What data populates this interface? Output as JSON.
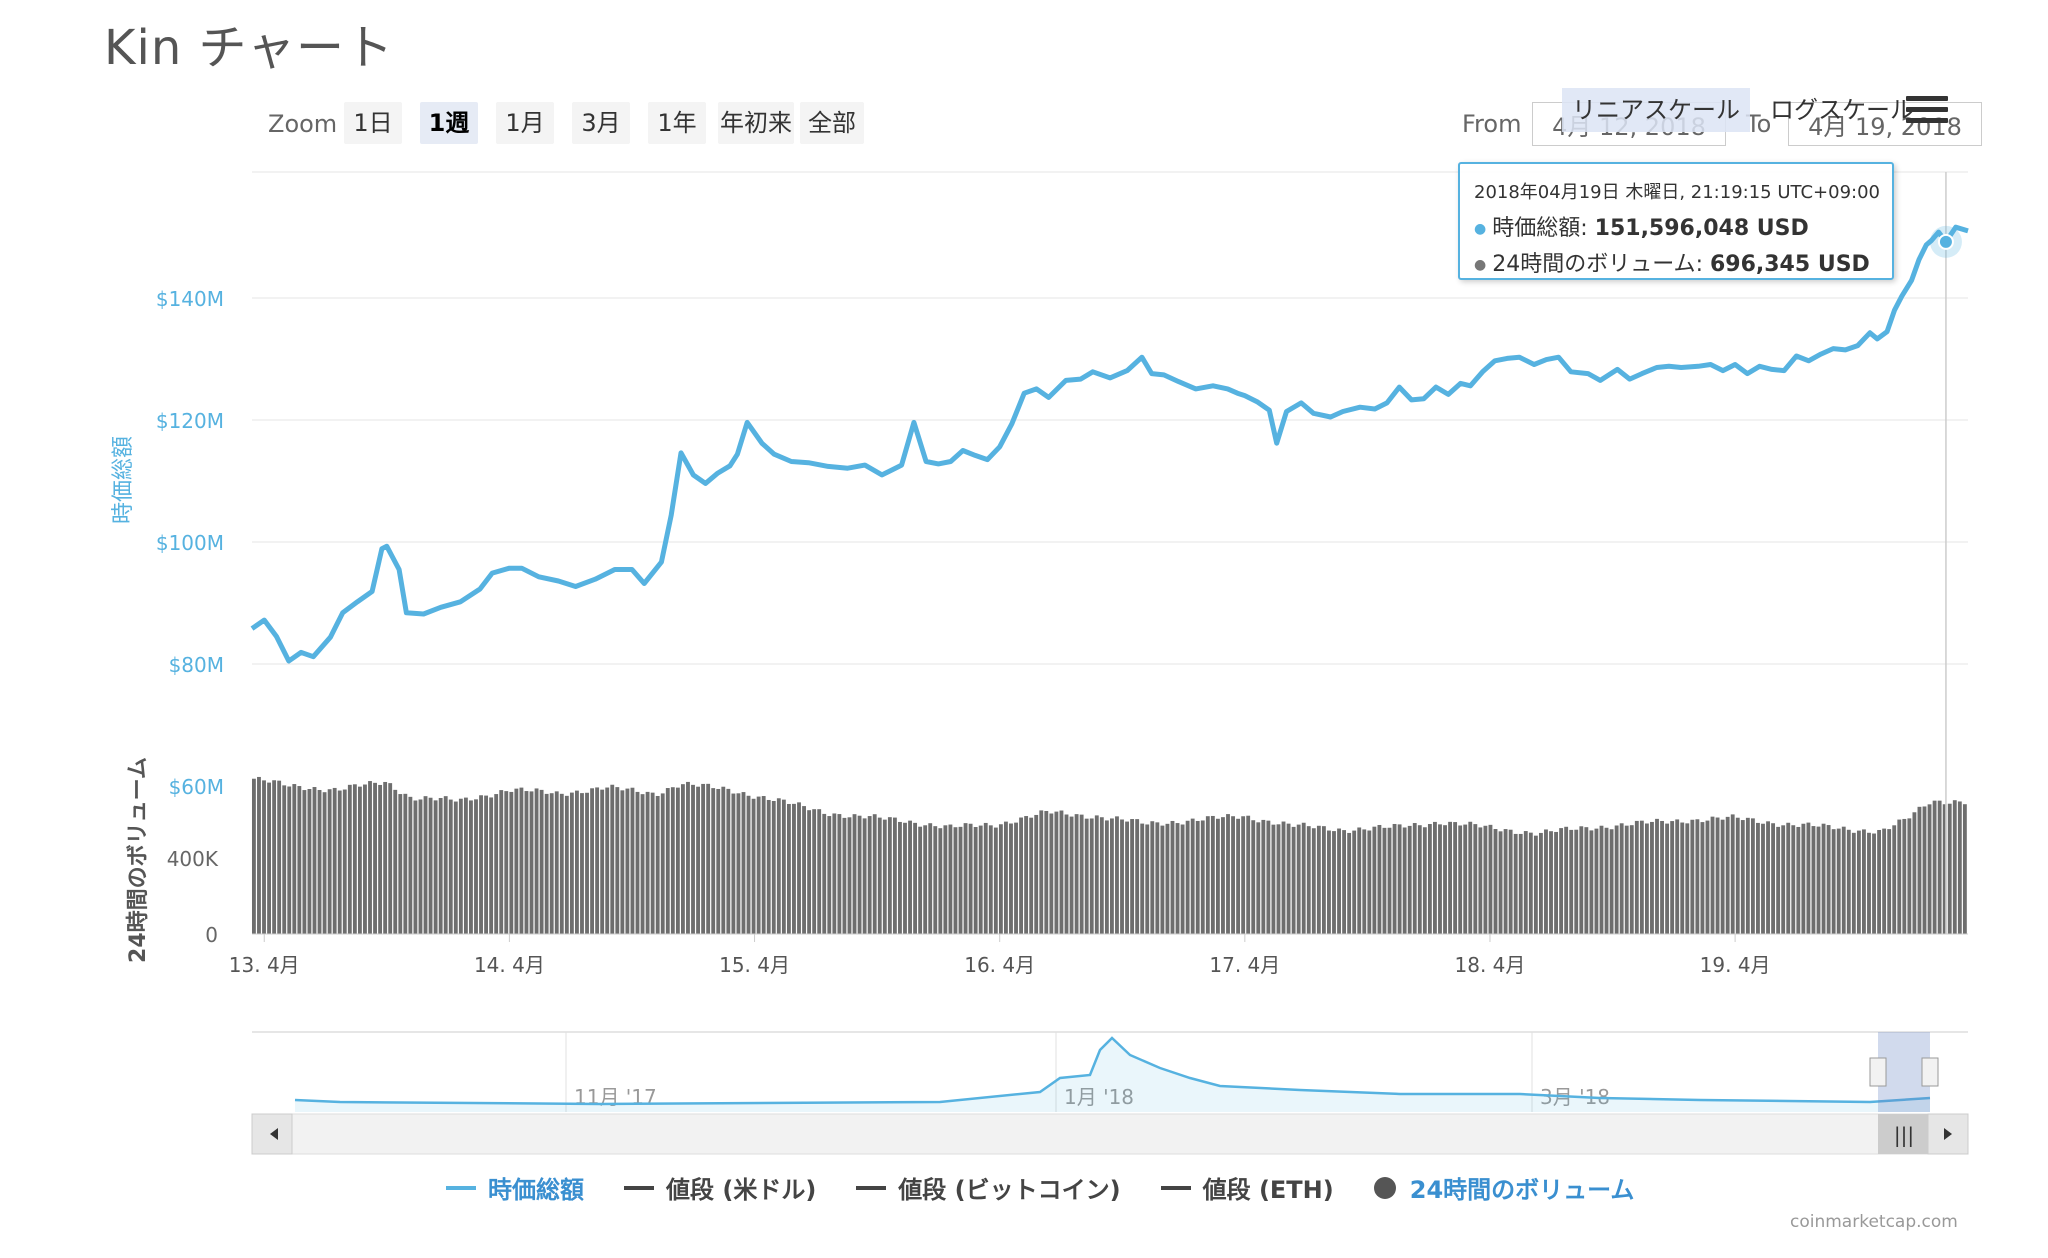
{
  "title": "Kin チャート",
  "toolbar": {
    "zoom_label": "Zoom",
    "zoom_buttons": [
      "1日",
      "1週",
      "1月",
      "3月",
      "1年",
      "年初来",
      "全部"
    ],
    "active_zoom": "1週",
    "scale_buttons": [
      "リニアスケール",
      "ログスケール"
    ],
    "from_label": "From",
    "from_value": "4月 12, 2018",
    "to_label": "To",
    "to_value": "4月 19, 2018",
    "menu_icon": "hamburger-menu-icon"
  },
  "tooltip": {
    "date": "2018年04月19日 木曜日, 21:19:15 UTC+09:00",
    "rows": [
      {
        "label": "時価総額",
        "value": "151,596,048 USD",
        "color": "#56b2e0"
      },
      {
        "label": "24時間のボリューム",
        "value": "696,345 USD",
        "color": "#777777"
      }
    ]
  },
  "chart_data": {
    "type": "line",
    "x_tick_labels": [
      "13. 4月",
      "14. 4月",
      "15. 4月",
      "16. 4月",
      "17. 4月",
      "18. 4月",
      "19. 4月"
    ],
    "x_range": [
      12.95,
      19.95
    ],
    "y_axis": {
      "label": "時価総額",
      "ticks": [
        "$140M",
        "$120M",
        "$100M",
        "$80M",
        "$60M"
      ],
      "tick_values": [
        140,
        120,
        100,
        80,
        60
      ],
      "ylim": [
        60,
        140
      ],
      "unit": "USD (millions)"
    },
    "y2_axis": {
      "label": "24時間のボリューム",
      "ticks": [
        "400K",
        "0"
      ],
      "tick_values": [
        400,
        0
      ],
      "unit": "USD (thousands)"
    },
    "grid": true,
    "series": [
      {
        "name": "時価総額",
        "kind": "line",
        "color": "#56b2e0",
        "points": [
          [
            12.95,
            85.8
          ],
          [
            13.0,
            87.2
          ],
          [
            13.05,
            84.5
          ],
          [
            13.1,
            80.5
          ],
          [
            13.15,
            81.9
          ],
          [
            13.2,
            81.2
          ],
          [
            13.27,
            84.4
          ],
          [
            13.32,
            88.4
          ],
          [
            13.38,
            90.2
          ],
          [
            13.44,
            91.9
          ],
          [
            13.48,
            98.9
          ],
          [
            13.5,
            99.3
          ],
          [
            13.55,
            95.5
          ],
          [
            13.58,
            88.4
          ],
          [
            13.65,
            88.2
          ],
          [
            13.72,
            89.3
          ],
          [
            13.8,
            90.2
          ],
          [
            13.88,
            92.3
          ],
          [
            13.93,
            94.9
          ],
          [
            14.0,
            95.7
          ],
          [
            14.05,
            95.7
          ],
          [
            14.12,
            94.3
          ],
          [
            14.2,
            93.6
          ],
          [
            14.27,
            92.7
          ],
          [
            14.35,
            93.9
          ],
          [
            14.43,
            95.5
          ],
          [
            14.5,
            95.5
          ],
          [
            14.55,
            93.2
          ],
          [
            14.62,
            96.7
          ],
          [
            14.66,
            104.4
          ],
          [
            14.7,
            114.6
          ],
          [
            14.75,
            111.0
          ],
          [
            14.8,
            109.6
          ],
          [
            14.85,
            111.3
          ],
          [
            14.9,
            112.5
          ],
          [
            14.93,
            114.4
          ],
          [
            14.97,
            119.6
          ],
          [
            15.03,
            116.2
          ],
          [
            15.08,
            114.4
          ],
          [
            15.15,
            113.2
          ],
          [
            15.22,
            113.0
          ],
          [
            15.3,
            112.4
          ],
          [
            15.38,
            112.1
          ],
          [
            15.45,
            112.6
          ],
          [
            15.52,
            111.0
          ],
          [
            15.6,
            112.6
          ],
          [
            15.65,
            119.6
          ],
          [
            15.7,
            113.2
          ],
          [
            15.75,
            112.8
          ],
          [
            15.8,
            113.2
          ],
          [
            15.85,
            115.0
          ],
          [
            15.9,
            114.2
          ],
          [
            15.95,
            113.5
          ],
          [
            16.0,
            115.6
          ],
          [
            16.05,
            119.4
          ],
          [
            16.1,
            124.4
          ],
          [
            16.15,
            125.1
          ],
          [
            16.2,
            123.7
          ],
          [
            16.27,
            126.5
          ],
          [
            16.33,
            126.7
          ],
          [
            16.38,
            127.9
          ],
          [
            16.45,
            126.9
          ],
          [
            16.52,
            128.1
          ],
          [
            16.58,
            130.3
          ],
          [
            16.62,
            127.6
          ],
          [
            16.67,
            127.4
          ],
          [
            16.73,
            126.3
          ],
          [
            16.8,
            125.1
          ],
          [
            16.87,
            125.6
          ],
          [
            16.93,
            125.1
          ],
          [
            16.97,
            124.4
          ],
          [
            17.0,
            124.0
          ],
          [
            17.05,
            123.0
          ],
          [
            17.1,
            121.6
          ],
          [
            17.13,
            116.2
          ],
          [
            17.17,
            121.4
          ],
          [
            17.23,
            122.8
          ],
          [
            17.28,
            121.1
          ],
          [
            17.35,
            120.5
          ],
          [
            17.4,
            121.4
          ],
          [
            17.47,
            122.1
          ],
          [
            17.53,
            121.8
          ],
          [
            17.58,
            122.8
          ],
          [
            17.63,
            125.4
          ],
          [
            17.68,
            123.3
          ],
          [
            17.73,
            123.5
          ],
          [
            17.78,
            125.4
          ],
          [
            17.83,
            124.2
          ],
          [
            17.88,
            126.0
          ],
          [
            17.92,
            125.6
          ],
          [
            17.97,
            127.9
          ],
          [
            18.02,
            129.7
          ],
          [
            18.07,
            130.1
          ],
          [
            18.12,
            130.3
          ],
          [
            18.18,
            129.1
          ],
          [
            18.23,
            129.9
          ],
          [
            18.28,
            130.3
          ],
          [
            18.33,
            127.9
          ],
          [
            18.4,
            127.6
          ],
          [
            18.45,
            126.5
          ],
          [
            18.52,
            128.3
          ],
          [
            18.57,
            126.7
          ],
          [
            18.62,
            127.6
          ],
          [
            18.68,
            128.6
          ],
          [
            18.73,
            128.8
          ],
          [
            18.78,
            128.6
          ],
          [
            18.85,
            128.8
          ],
          [
            18.9,
            129.1
          ],
          [
            18.95,
            128.1
          ],
          [
            19.0,
            129.1
          ],
          [
            19.05,
            127.6
          ],
          [
            19.1,
            128.8
          ],
          [
            19.15,
            128.3
          ],
          [
            19.2,
            128.1
          ],
          [
            19.25,
            130.5
          ],
          [
            19.3,
            129.7
          ],
          [
            19.35,
            130.8
          ],
          [
            19.4,
            131.7
          ],
          [
            19.45,
            131.5
          ],
          [
            19.5,
            132.2
          ],
          [
            19.55,
            134.3
          ],
          [
            19.58,
            133.3
          ],
          [
            19.62,
            134.5
          ],
          [
            19.65,
            138.0
          ],
          [
            19.68,
            140.3
          ],
          [
            19.72,
            142.9
          ],
          [
            19.75,
            146.3
          ],
          [
            19.78,
            148.7
          ],
          [
            19.8,
            149.4
          ],
          [
            19.83,
            150.8
          ],
          [
            19.86,
            149.2
          ],
          [
            19.9,
            151.6
          ],
          [
            19.95,
            151.0
          ]
        ]
      },
      {
        "name": "24時間のボリューム",
        "kind": "column",
        "color": "#777777",
        "points": [
          [
            12.95,
            820
          ],
          [
            13.1,
            780
          ],
          [
            13.3,
            760
          ],
          [
            13.5,
            800
          ],
          [
            13.6,
            720
          ],
          [
            13.8,
            700
          ],
          [
            14.0,
            760
          ],
          [
            14.2,
            740
          ],
          [
            14.4,
            770
          ],
          [
            14.6,
            740
          ],
          [
            14.7,
            790
          ],
          [
            14.9,
            760
          ],
          [
            15.1,
            700
          ],
          [
            15.3,
            640
          ],
          [
            15.4,
            620
          ],
          [
            15.6,
            600
          ],
          [
            15.8,
            560
          ],
          [
            16.0,
            580
          ],
          [
            16.2,
            640
          ],
          [
            16.4,
            620
          ],
          [
            16.6,
            580
          ],
          [
            16.8,
            600
          ],
          [
            17.0,
            620
          ],
          [
            17.2,
            570
          ],
          [
            17.4,
            550
          ],
          [
            17.6,
            560
          ],
          [
            17.8,
            590
          ],
          [
            18.0,
            560
          ],
          [
            18.2,
            530
          ],
          [
            18.4,
            560
          ],
          [
            18.6,
            580
          ],
          [
            18.8,
            600
          ],
          [
            19.0,
            610
          ],
          [
            19.2,
            580
          ],
          [
            19.4,
            560
          ],
          [
            19.6,
            540
          ],
          [
            19.7,
            600
          ],
          [
            19.8,
            700
          ],
          [
            19.9,
            700
          ],
          [
            19.95,
            696
          ]
        ]
      }
    ],
    "navigator": {
      "x_tick_labels": [
        "11月 '17",
        "1月 '18",
        "3月 '18"
      ]
    },
    "legend": [
      {
        "name": "時価総額",
        "color": "#56b2e0",
        "symbol": "line",
        "active": true
      },
      {
        "name": "値段 (米ドル)",
        "color": "#444444",
        "symbol": "line",
        "active": false
      },
      {
        "name": "値段 (ビットコイン)",
        "color": "#444444",
        "symbol": "line",
        "active": false
      },
      {
        "name": "値段 (ETH)",
        "color": "#444444",
        "symbol": "line",
        "active": false
      },
      {
        "name": "24時間のボリューム",
        "color": "#555555",
        "symbol": "dot",
        "active": true
      }
    ],
    "legend_placement": "bottom"
  },
  "credit": "coinmarketcap.com"
}
